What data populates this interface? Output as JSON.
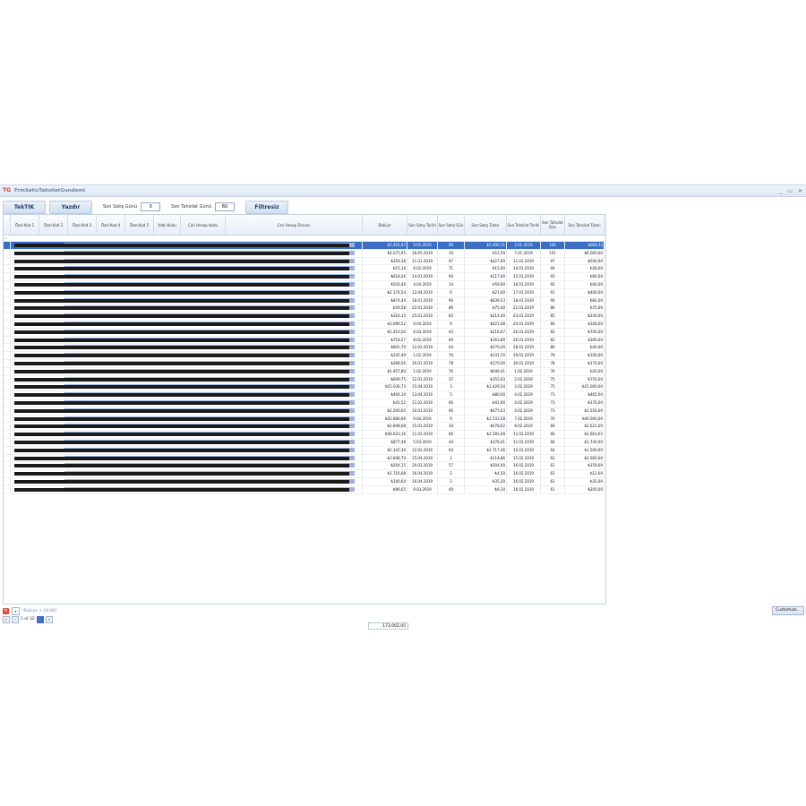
{
  "window": {
    "title": "FrmSatisTahsilatGundemi",
    "app_icon": "TG",
    "controls": [
      "_",
      "▭",
      "✕"
    ]
  },
  "toolbar": {
    "tektik_label": "TekTIK",
    "yazdir_label": "Yazdır",
    "son_satis_label": "Son Satış Günü",
    "son_satis_value": "0",
    "son_tahsilat_label": "Son Tahsilat Günü",
    "son_tahsilat_value": "60",
    "filtresiz_label": "Filtresiz"
  },
  "grid": {
    "columns": [
      "Özel Kod 1",
      "Özel Kod 2",
      "Özel Kod 3",
      "Özel Kod 4",
      "Özel Kod 5",
      "Yetki Kodu",
      "Cari Hesap Kodu",
      "Cari Hesap Ünvanı",
      "Bakiye",
      "Son Satış Tarihi",
      "Son Satış Gün",
      "Son Satış Tutarı",
      "Son Tahsilat Tarihi",
      "Son Tahsilat Gün",
      "Son Tahsilat Tutarı"
    ],
    "rows": [
      [
        "₺5.401,67",
        "9.01.2019",
        "89",
        "₺5.400,11",
        "2.01.2019",
        "106",
        "₺668,34"
      ],
      [
        "₺4.075,95",
        "30.05.2019",
        "19",
        "₺51,59",
        "7.01.2019",
        "101",
        "₺6.000,00"
      ],
      [
        "₺359,18",
        "11.01.2019",
        "97",
        "₺427,00",
        "11.01.2019",
        "97",
        "₺500,00"
      ],
      [
        "₺15,16",
        "6.02.2019",
        "71",
        "₺15,00",
        "14.01.2019",
        "94",
        "₺28,00"
      ],
      [
        "₺618,26",
        "14.01.2019",
        "94",
        "₺117,00",
        "15.01.2019",
        "93",
        "₺60,00"
      ],
      [
        "₺543,46",
        "4.04.2019",
        "14",
        "₺59,60",
        "16.01.2019",
        "92",
        "₺40,00"
      ],
      [
        "₺2.174,54",
        "12.04.2019",
        "6",
        "₺21,00",
        "17.01.2019",
        "91",
        "₺400,00"
      ],
      [
        "₺874,44",
        "18.01.2019",
        "90",
        "₺639,53",
        "18.01.2019",
        "90",
        "₺60,00"
      ],
      [
        "₺59,58",
        "22.01.2019",
        "86",
        "₺75,00",
        "22.01.2019",
        "86",
        "₺75,00"
      ],
      [
        "₺316,15",
        "25.01.2019",
        "83",
        "₺214,00",
        "23.01.2019",
        "85",
        "₺240,00"
      ],
      [
        "₺3.696,52",
        "9.04.2019",
        "9",
        "₺421,68",
        "24.01.2019",
        "84",
        "₺328,00"
      ],
      [
        "₺5.410,50",
        "6.03.2019",
        "43",
        "₺216,67",
        "26.01.2019",
        "82",
        "₺700,00"
      ],
      [
        "₺718,57",
        "8.02.2019",
        "69",
        "₺163,80",
        "26.01.2019",
        "82",
        "₺300,00"
      ],
      [
        "₺801,70",
        "12.02.2019",
        "64",
        "₺270,00",
        "28.01.2019",
        "80",
        "₺40,00"
      ],
      [
        "₺245,49",
        "1.02.2019",
        "76",
        "₺131,70",
        "29.01.2019",
        "79",
        "₺100,00"
      ],
      [
        "₺268,56",
        "30.01.2019",
        "78",
        "₺170,00",
        "30.01.2019",
        "78",
        "₺170,00"
      ],
      [
        "₺1.957,80",
        "1.02.2019",
        "76",
        "₺649,41",
        "1.02.2019",
        "76",
        "₺20,00"
      ],
      [
        "₺609,75",
        "12.03.2019",
        "37",
        "₺352,93",
        "2.02.2019",
        "75",
        "₺750,00"
      ],
      [
        "₺15.036,73",
        "15.04.2019",
        "3",
        "₺1.429,54",
        "2.02.2019",
        "75",
        "₺15.000,00"
      ],
      [
        "₺404,10",
        "13.04.2019",
        "5",
        "₺80,00",
        "4.02.2019",
        "73",
        "₺465,00"
      ],
      [
        "₺41,52",
        "11.02.2019",
        "66",
        "₺41,90",
        "4.02.2019",
        "73",
        "₺176,00"
      ],
      [
        "₺2.200,05",
        "10.01.2019",
        "90",
        "₺475,03",
        "4.02.2019",
        "73",
        "₺1.556,00"
      ],
      [
        "₺52.880,66",
        "9.04.2019",
        "9",
        "₺1.533,58",
        "7.02.2019",
        "70",
        "₺40.000,00"
      ],
      [
        "₺2.848,08",
        "15.03.2019",
        "34",
        "₺578,62",
        "8.02.2019",
        "69",
        "₺2.621,00"
      ],
      [
        "₺58.623,16",
        "11.02.2019",
        "66",
        "₺2.392,49",
        "11.02.2019",
        "66",
        "₺1.663,02"
      ],
      [
        "₺877,48",
        "5.03.2019",
        "44",
        "₺376,01",
        "11.02.2019",
        "66",
        "₺1.740,00"
      ],
      [
        "₺5.342,30",
        "12.02.2019",
        "64",
        "₺2.717,46",
        "12.02.2019",
        "64",
        "₺1.500,00"
      ],
      [
        "₺3.848,70",
        "15.04.2019",
        "3",
        "₺114,86",
        "15.02.2019",
        "62",
        "₺2.000,00"
      ],
      [
        "₺204,15",
        "20.02.2019",
        "57",
        "₺204,00",
        "16.02.2019",
        "61",
        "₺159,00"
      ],
      [
        "₺1.716,08",
        "16.04.2019",
        "2",
        "₺4,50",
        "16.02.2019",
        "61",
        "₺12,00"
      ],
      [
        "₺100,64",
        "16.04.2019",
        "2",
        "₺35,20",
        "16.02.2019",
        "61",
        "₺35,00"
      ],
      [
        "₺96,65",
        "9.03.2019",
        "40",
        "₺9,10",
        "16.02.2019",
        "61",
        "₺200,00"
      ]
    ],
    "total_bakiye": "173.002,05"
  },
  "status": {
    "filter_text": "[Bakiye > 10,00]",
    "customize_label": "Customize...",
    "page_text": "1 of 32"
  },
  "colors": {
    "selection": "#3a6fc5",
    "accent": "#1f3a60"
  }
}
